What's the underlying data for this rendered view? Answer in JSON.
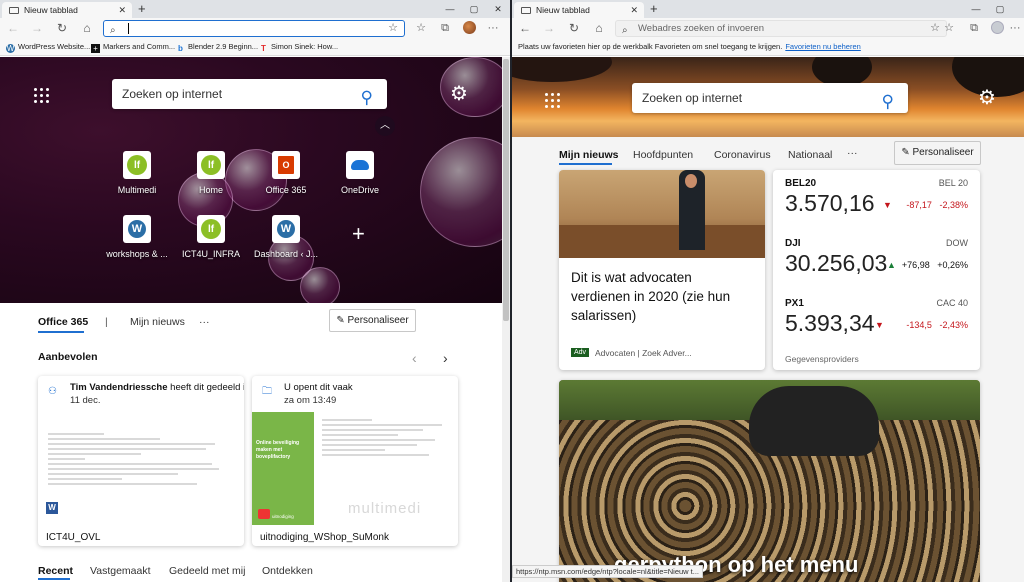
{
  "left_window": {
    "tab_title": "Nieuw tabblad",
    "tab_close": "✕",
    "new_tab": "+",
    "window_controls": [
      "—",
      "▢",
      "✕"
    ],
    "address_value": "",
    "address_icon": "search-icon",
    "bookmarks": [
      {
        "label": "WordPress Website...",
        "color": "#2b6ea6",
        "glyph": "W"
      },
      {
        "label": "Markers and Comm...",
        "color": "#111111",
        "glyph": "+"
      },
      {
        "label": "Blender 2.9 Beginn...",
        "color": "#1a73d6",
        "glyph": "b"
      },
      {
        "label": "Simon Sinek: How...",
        "color": "#e22b2b",
        "glyph": "T"
      }
    ],
    "search_placeholder": "Zoeken op internet",
    "tiles": [
      {
        "label": "Multimedi",
        "icon": "lf"
      },
      {
        "label": "Home",
        "icon": "lf"
      },
      {
        "label": "Office 365",
        "icon": "office"
      },
      {
        "label": "OneDrive",
        "icon": "onedrive"
      },
      {
        "label": "workshops & ...",
        "icon": "wordpress"
      },
      {
        "label": "ICT4U_INFRA",
        "icon": "lf"
      },
      {
        "label": "Dashboard ‹ J...",
        "icon": "wordpress"
      }
    ],
    "nav": {
      "office365": "Office 365",
      "separator": "|",
      "mijn_nieuws": "Mijn nieuws",
      "more": "···"
    },
    "personalize": "Personaliseer",
    "recommended_title": "Aanbevolen",
    "cards": [
      {
        "author": "Tim Vandendriessche",
        "action": "heeft dit gedeeld in ...",
        "date": "11 dec.",
        "file": "ICT4U_OVL"
      },
      {
        "action": "U opent dit vaak",
        "date": "za om 13:49",
        "file": "uitnodiging_WShop_SuMonk",
        "preview_title": "Online beveiliging maken met boveplifactory",
        "preview_brand": "multimedi",
        "preview_badge": "uitnodiging"
      }
    ],
    "bottom_tabs": [
      "Recent",
      "Vastgemaakt",
      "Gedeeld met mij",
      "Ontdekken"
    ]
  },
  "right_window": {
    "tab_title": "Nieuw tabblad",
    "address_placeholder": "Webadres zoeken of invoeren",
    "fav_message": "Plaats uw favorieten hier op de werkbalk Favorieten om snel toegang te krijgen.",
    "fav_link": "Favorieten nu beheren",
    "search_placeholder": "Zoeken op internet",
    "nav": [
      "Mijn nieuws",
      "Hoofdpunten",
      "Coronavirus",
      "Nationaal"
    ],
    "more": "···",
    "personalize": "Personaliseer",
    "article": {
      "title": "Dit is wat advocaten verdienen in 2020 (zie hun salarissen)",
      "badge": "Adv",
      "source": "Advocaten | Zoek Adver..."
    },
    "stocks": [
      {
        "name": "BEL20",
        "index": "BEL 20",
        "value": "3.570,16",
        "change": "-87,17",
        "pct": "-2,38%",
        "dir": "down"
      },
      {
        "name": "DJI",
        "index": "DOW",
        "value": "30.256,03",
        "change": "+76,98",
        "pct": "+0,26%",
        "dir": "up"
      },
      {
        "name": "PX1",
        "index": "CAC 40",
        "value": "5.393,34",
        "change": "-134,5",
        "pct": "-2,43%",
        "dir": "down"
      }
    ],
    "providers": "Gegevensproviders",
    "bottom_headline": "gerpython op het menu",
    "status_url": "https://ntp.msn.com/edge/ntp?locale=nl&title=Nieuw t..."
  }
}
